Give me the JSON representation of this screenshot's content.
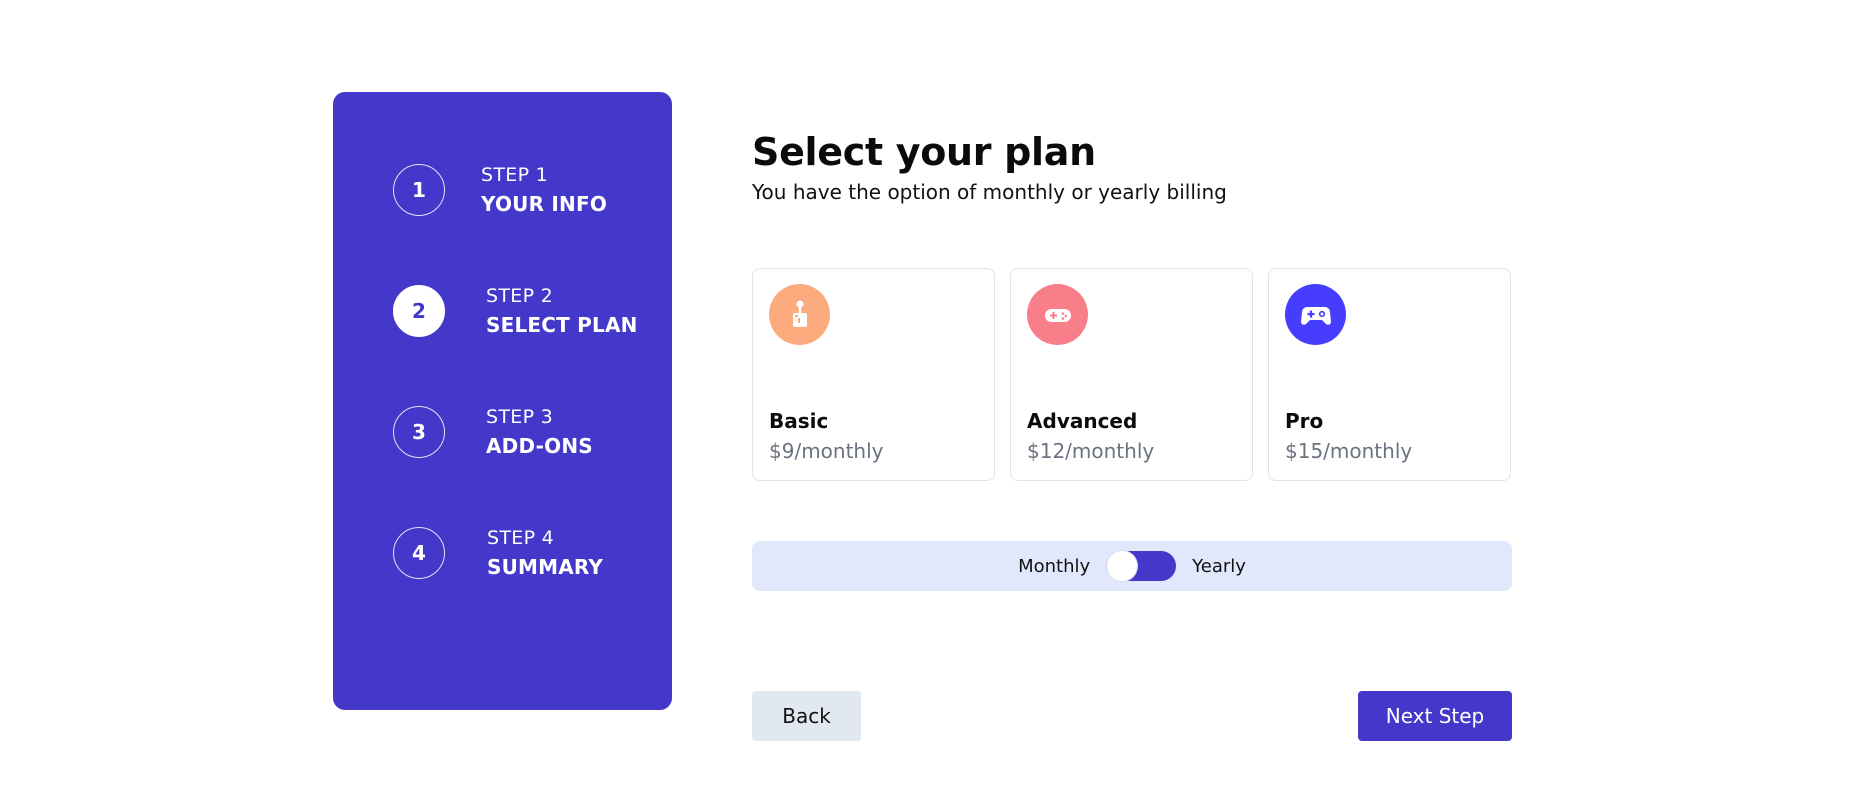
{
  "colors": {
    "sidebar_bg": "#4338ca",
    "accent": "#4338ca",
    "toggle_bar_bg": "#e2e8fb",
    "back_button_bg": "#e2e8f0",
    "price_text": "#6b7280",
    "basic_icon_bg": "#fbab7e",
    "advanced_icon_bg": "#f87f8a",
    "pro_icon_bg": "#473dff"
  },
  "sidebar": {
    "steps": [
      {
        "number": "1",
        "label": "STEP 1",
        "title": "YOUR INFO",
        "active": false
      },
      {
        "number": "2",
        "label": "STEP 2",
        "title": "SELECT PLAN",
        "active": true
      },
      {
        "number": "3",
        "label": "STEP 3",
        "title": "ADD-ONS",
        "active": false
      },
      {
        "number": "4",
        "label": "STEP 4",
        "title": "SUMMARY",
        "active": false
      }
    ]
  },
  "main": {
    "title": "Select your plan",
    "subtitle": "You have the option of monthly or yearly billing",
    "plans": [
      {
        "name": "Basic",
        "price": "$9/monthly",
        "icon": "arcade-joystick-icon"
      },
      {
        "name": "Advanced",
        "price": "$12/monthly",
        "icon": "gamepad-icon"
      },
      {
        "name": "Pro",
        "price": "$15/monthly",
        "icon": "controller-icon"
      }
    ],
    "billing_toggle": {
      "left_label": "Monthly",
      "right_label": "Yearly",
      "selected": "Monthly"
    },
    "buttons": {
      "back": "Back",
      "next": "Next Step"
    }
  }
}
